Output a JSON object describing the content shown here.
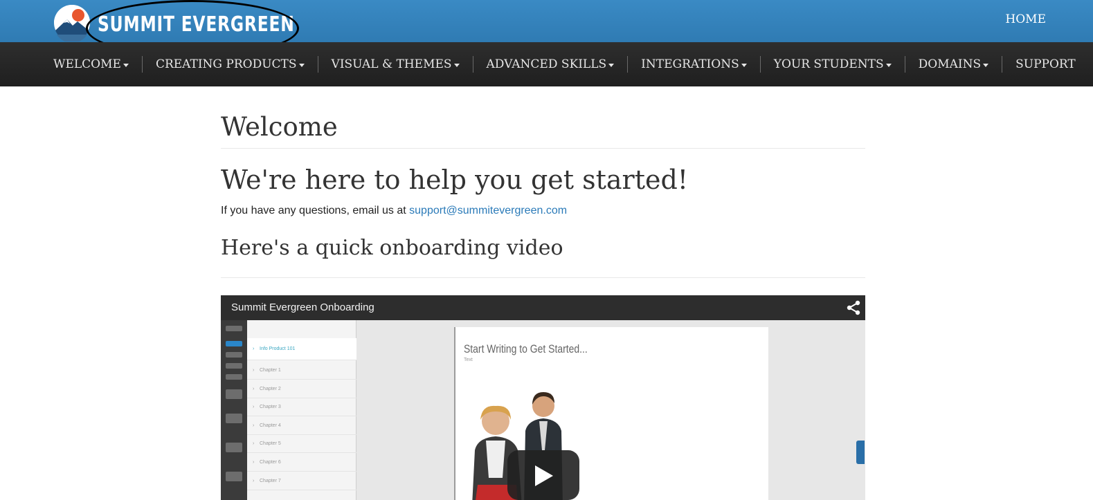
{
  "brand": {
    "name": "SUMMIT EVERGREEN",
    "accent": "#2f7bb3"
  },
  "topbar": {
    "home_label": "HOME"
  },
  "nav": {
    "items": [
      {
        "label": "WELCOME",
        "dropdown": true
      },
      {
        "label": "CREATING PRODUCTS",
        "dropdown": true
      },
      {
        "label": "VISUAL & THEMES",
        "dropdown": true
      },
      {
        "label": "ADVANCED SKILLS",
        "dropdown": true
      },
      {
        "label": "INTEGRATIONS",
        "dropdown": true
      },
      {
        "label": "YOUR STUDENTS",
        "dropdown": true
      },
      {
        "label": "DOMAINS",
        "dropdown": true
      },
      {
        "label": "SUPPORT",
        "dropdown": false
      }
    ]
  },
  "main": {
    "page_title": "Welcome",
    "hero": "We're here to help you get started!",
    "contact_prefix": "If you have any questions, email us at ",
    "contact_email": "support@summitevergreen.com",
    "video_heading": "Here's a quick onboarding video"
  },
  "video": {
    "title": "Summit Evergreen Onboarding",
    "preview": {
      "page_heading": "Start Writing to Get Started...",
      "page_sub": "Text",
      "featured_item": "Info Product 101",
      "list_items": [
        "Chapter 1",
        "Chapter 2",
        "Chapter 3",
        "Chapter 4",
        "Chapter 5",
        "Chapter 6",
        "Chapter 7"
      ]
    }
  }
}
